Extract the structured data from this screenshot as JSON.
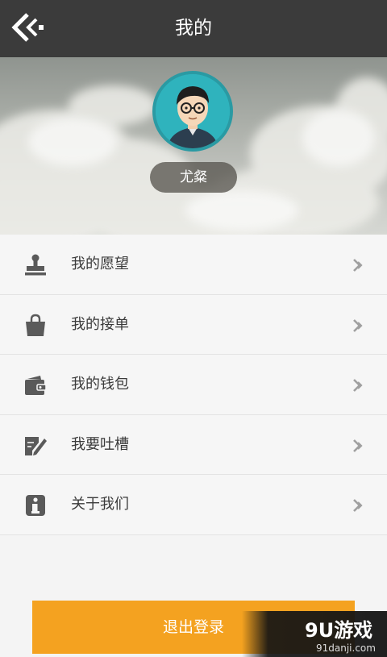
{
  "header": {
    "title": "我的"
  },
  "profile": {
    "username": "尤粲"
  },
  "menu": {
    "items": [
      {
        "label": "我的愿望",
        "icon": "stamp-icon"
      },
      {
        "label": "我的接单",
        "icon": "shopping-bag-icon"
      },
      {
        "label": "我的钱包",
        "icon": "wallet-icon"
      },
      {
        "label": "我要吐槽",
        "icon": "edit-note-icon"
      },
      {
        "label": "关于我们",
        "icon": "info-icon"
      }
    ]
  },
  "footer": {
    "logout_label": "退出登录"
  },
  "watermark": {
    "brand": "9U游戏",
    "url": "91danji.com"
  },
  "colors": {
    "topbar": "#3b3b3b",
    "accent": "#f4a220",
    "avatar_ring": "#2a9aa3",
    "icon": "#5a5a5a"
  }
}
